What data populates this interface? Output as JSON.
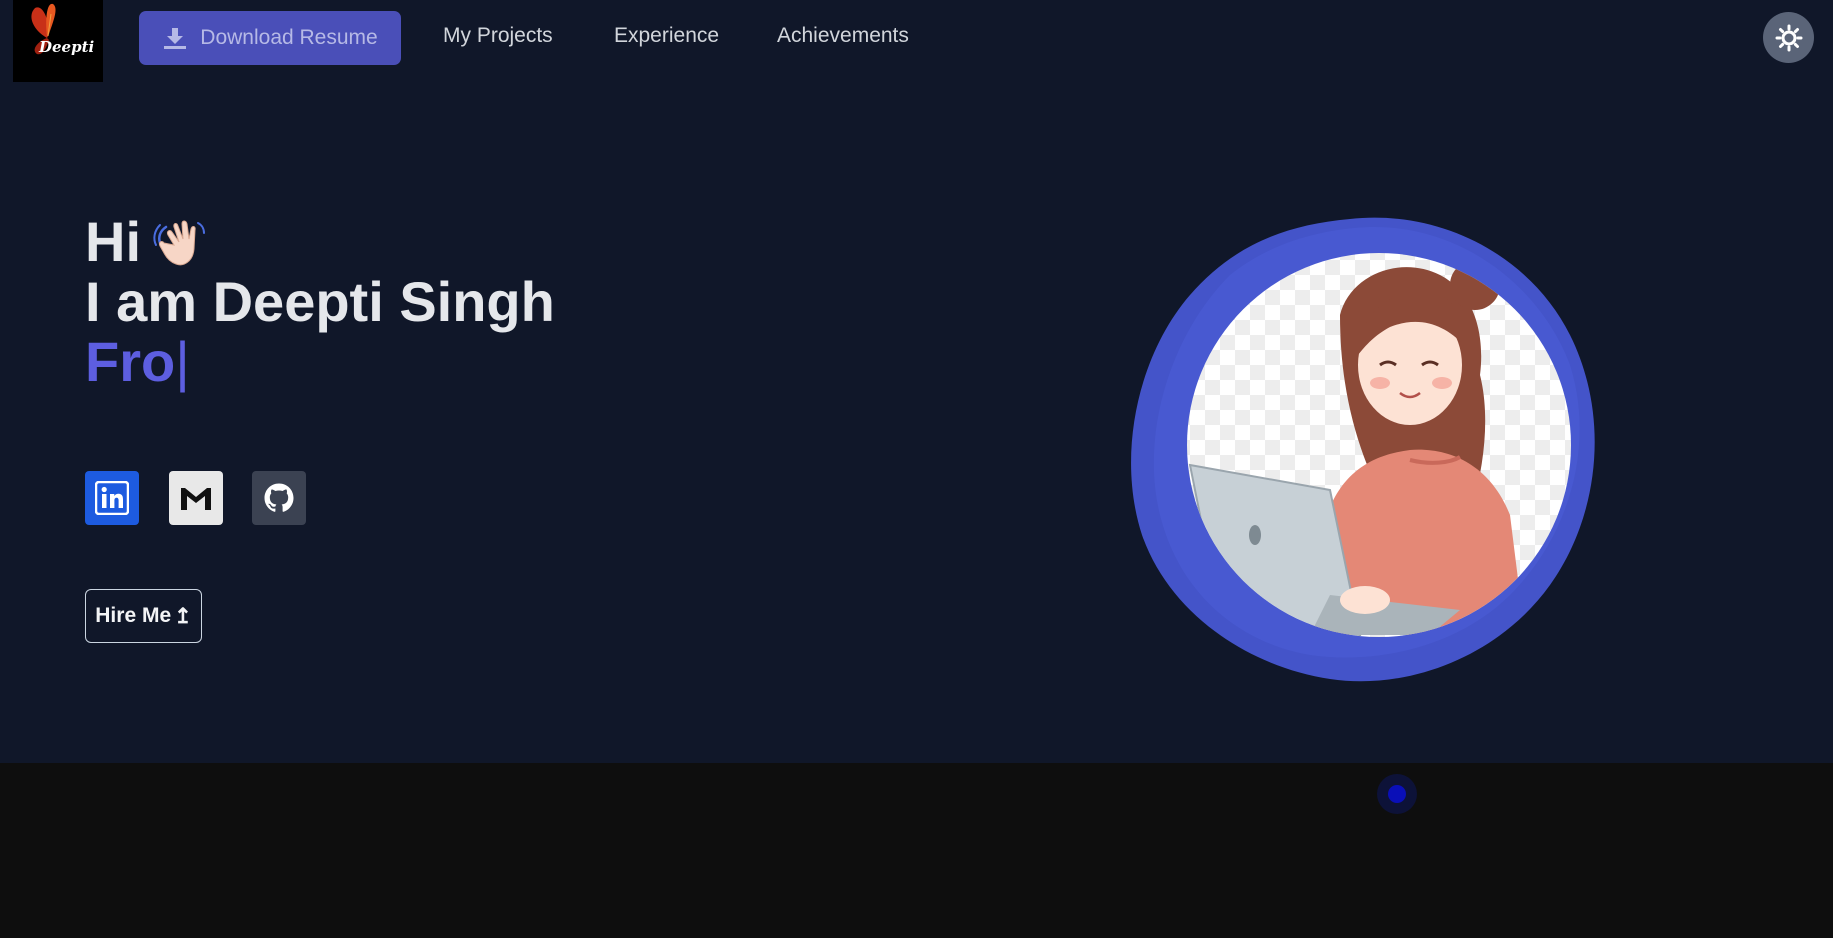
{
  "header": {
    "logo_text": "Deepti",
    "download_label": "Download Resume",
    "nav": [
      {
        "label": "My Projects"
      },
      {
        "label": "Experience"
      },
      {
        "label": "Achievements"
      }
    ]
  },
  "hero": {
    "greeting": "Hi",
    "intro": "I am Deepti Singh",
    "typed_role": "Fro",
    "caret": "|",
    "hire_label": "Hire Me",
    "hire_arrow": "↥"
  },
  "social": [
    {
      "name": "linkedin",
      "icon": "linkedin-icon"
    },
    {
      "name": "gmail",
      "icon": "gmail-icon"
    },
    {
      "name": "github",
      "icon": "github-icon"
    }
  ],
  "colors": {
    "hero_bg": "#101729",
    "accent": "#5d5ee0",
    "resume_button": "#4a4fb8",
    "blob": "#4454c9"
  }
}
